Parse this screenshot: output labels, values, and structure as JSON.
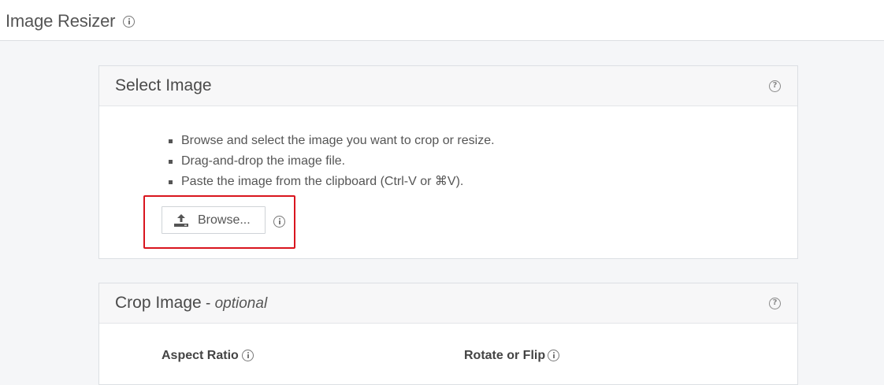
{
  "app": {
    "title": "Image Resizer"
  },
  "select_panel": {
    "title": "Select Image",
    "instructions": [
      "Browse and select the image you want to crop or resize.",
      "Drag-and-drop the image file.",
      "Paste the image from the clipboard (Ctrl-V or ⌘V)."
    ],
    "browse_label": "Browse...",
    "browse_icon": "upload-icon"
  },
  "crop_panel": {
    "title": "Crop Image",
    "title_suffix": " - ",
    "optional_label": "optional",
    "aspect_ratio_label": "Aspect Ratio",
    "rotate_flip_label": "Rotate or Flip"
  },
  "colors": {
    "highlight": "#d9151e",
    "header_bg": "#f7f7f8",
    "page_bg": "#f5f6f8"
  }
}
